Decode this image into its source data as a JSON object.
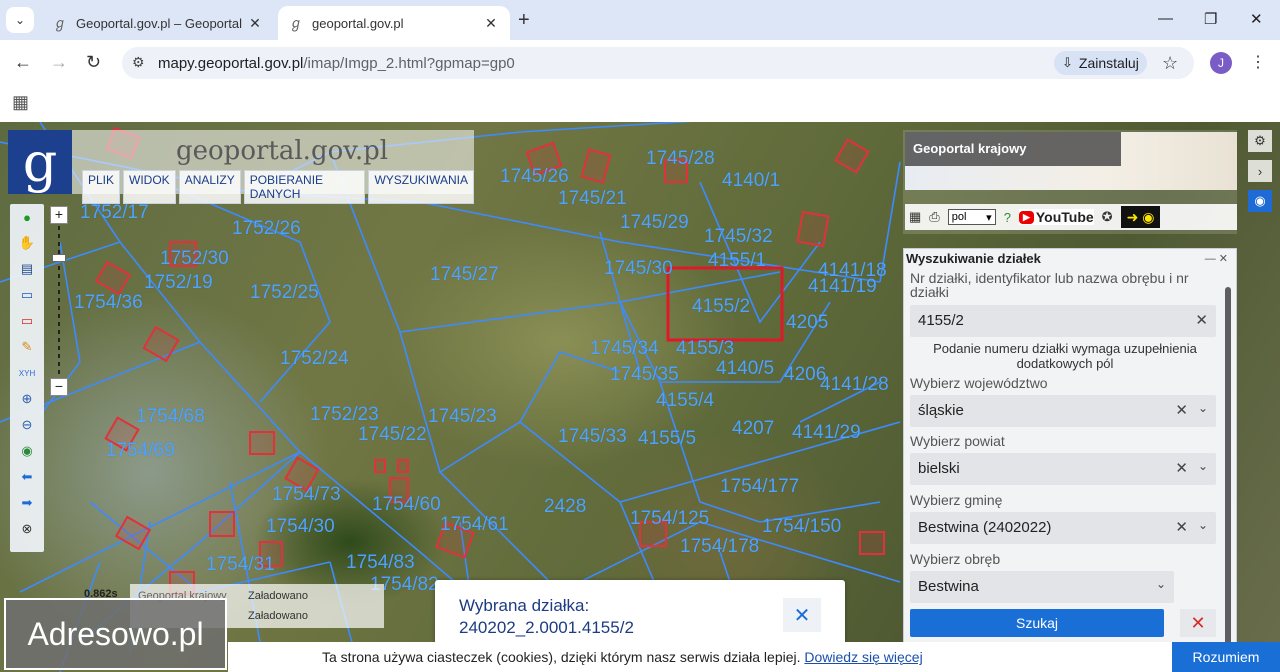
{
  "browser": {
    "tabs": [
      {
        "title": "Geoportal.gov.pl – Geoportal Infrastruktury Informacji Przestrzennej",
        "active": false
      },
      {
        "title": "geoportal.gov.pl",
        "active": true
      }
    ],
    "url_host": "mapy.geoportal.gov.pl",
    "url_path": "/imap/Imgp_2.html?gpmap=gp0",
    "install_label": "Zainstaluj",
    "avatar_letter": "J"
  },
  "app": {
    "logo_text": "geoportal.gov.pl",
    "menu": [
      "PLIK",
      "WIDOK",
      "ANALIZY",
      "POBIERANIE DANYCH",
      "WYSZUKIWANIA"
    ],
    "minimap_title": "Geoportal krajowy",
    "language": "pol",
    "youtube_label": "YouTube"
  },
  "parcel_labels": [
    "1752/17",
    "1752/26",
    "1752/25",
    "1745/27",
    "1745/23",
    "1745/22",
    "1752/23",
    "1752/24",
    "1745/34",
    "1745/35",
    "1745/33",
    "4155/1",
    "4155/2",
    "4155/3",
    "4155/4",
    "4155/5",
    "4140/5",
    "4140/1",
    "4205",
    "4206",
    "4207",
    "4141/18",
    "4141/19",
    "4141/28",
    "4141/29",
    "1745/29",
    "1745/21",
    "1745/26",
    "1745/28",
    "1745/30",
    "1745/32",
    "1754/36",
    "1754/68",
    "1754/69",
    "1754/60",
    "1754/61",
    "1754/73",
    "1754/177",
    "1754/125",
    "1754/150",
    "1754/178",
    "1754/31",
    "1754/30",
    "1754/83",
    "1754/82",
    "2428",
    "1752/19",
    "1752/30"
  ],
  "search_panel": {
    "title": "Wyszukiwanie działek",
    "query_label": "Nr działki, identyfikator lub nazwa obrębu i nr działki",
    "query_value": "4155/2",
    "note": "Podanie numeru działki wymaga uzupełnienia dodatkowych pól",
    "wojewodztwo_label": "Wybierz województwo",
    "wojewodztwo_value": "śląskie",
    "powiat_label": "Wybierz powiat",
    "powiat_value": "bielski",
    "gmina_label": "Wybierz gminę",
    "gmina_value": "Bestwina (2402022)",
    "obreb_label": "Wybierz obręb",
    "obreb_value": "Bestwina",
    "search_button": "Szukaj"
  },
  "selection": {
    "title": "Wybrana działka:",
    "identifier": "240202_2.0001.4155/2"
  },
  "layers": {
    "scale": "0.862s",
    "rows": [
      {
        "name": "Geoportal krajowy",
        "status": "Załadowano"
      },
      {
        "name": "",
        "status": "Załadowano"
      }
    ]
  },
  "watermark": "Adresowo.pl",
  "cookie": {
    "text": "Ta strona używa ciasteczek (cookies), dzięki którym nasz serwis działa lepiej.",
    "link": "Dowiedz się więcej",
    "accept": "Rozumiem"
  },
  "colors": {
    "parcel_line": "#3d8bff",
    "building": "#e0323a",
    "selection": "#e0192a",
    "accent": "#1a6fd6"
  }
}
